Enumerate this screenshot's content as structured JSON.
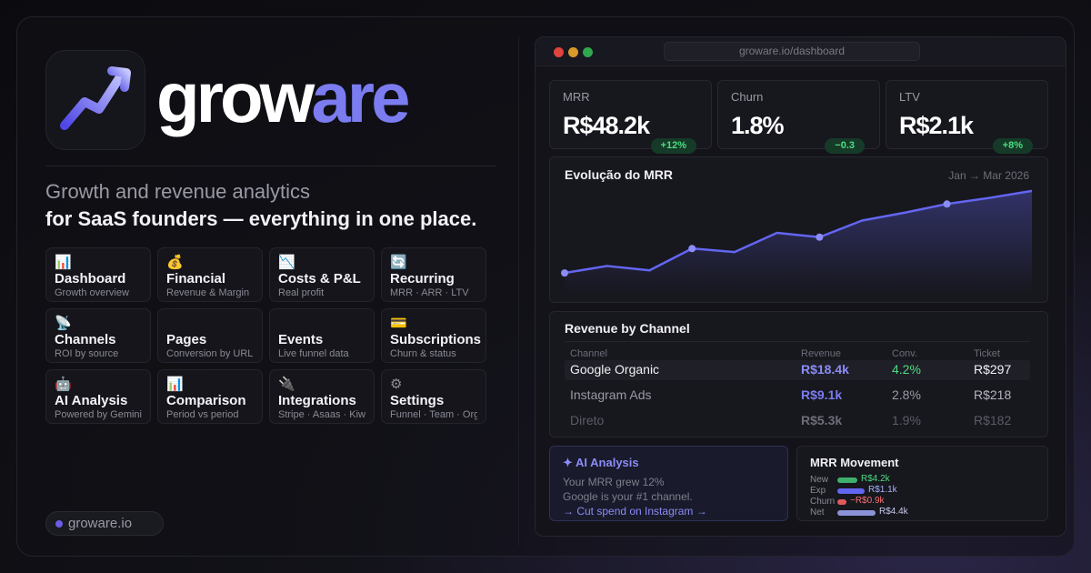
{
  "brand": {
    "name_part1": "grow",
    "name_part2": "are",
    "site": "groware.io"
  },
  "tagline": {
    "line1": "Growth and revenue analytics",
    "line2": "for SaaS founders — everything in one place."
  },
  "features": [
    {
      "icon": "bar-chart-icon",
      "glyph": "📊",
      "title": "Dashboard",
      "subtitle": "Growth overview"
    },
    {
      "icon": "money-bag-icon",
      "glyph": "💰",
      "title": "Financial",
      "subtitle": "Revenue & Margin"
    },
    {
      "icon": "trend-down-icon",
      "glyph": "📉",
      "title": "Costs & P&L",
      "subtitle": "Real profit"
    },
    {
      "icon": "refresh-icon",
      "glyph": "🔄",
      "title": "Recurring",
      "subtitle": "MRR · ARR · LTV"
    },
    {
      "icon": "satellite-icon",
      "glyph": "📡",
      "title": "Channels",
      "subtitle": "ROI by source"
    },
    {
      "icon": "page-icon",
      "glyph": "",
      "title": "Pages",
      "subtitle": "Conversion by URL"
    },
    {
      "icon": "event-icon",
      "glyph": "",
      "title": "Events",
      "subtitle": "Live funnel data"
    },
    {
      "icon": "card-icon",
      "glyph": "💳",
      "title": "Subscriptions",
      "subtitle": "Churn & status"
    },
    {
      "icon": "robot-icon",
      "glyph": "🤖",
      "title": "AI Analysis",
      "subtitle": "Powered by Gemini"
    },
    {
      "icon": "bar-chart-icon",
      "glyph": "📊",
      "title": "Comparison",
      "subtitle": "Period vs period"
    },
    {
      "icon": "plug-icon",
      "glyph": "🔌",
      "title": "Integrations",
      "subtitle": "Stripe · Asaas · Kiwify"
    },
    {
      "icon": "gear-icon",
      "glyph": "⚙",
      "title": "Settings",
      "subtitle": "Funnel · Team · Org"
    }
  ],
  "browser": {
    "url": "groware.io/dashboard"
  },
  "kpis": [
    {
      "label": "MRR",
      "value": "R$48.2k",
      "delta": "+12%"
    },
    {
      "label": "Churn",
      "value": "1.8%",
      "delta": "−0.3"
    },
    {
      "label": "LTV",
      "value": "R$2.1k",
      "delta": "+8%"
    }
  ],
  "mrr_chart": {
    "title": "Evolução do MRR",
    "range": "Jan → Mar 2026"
  },
  "chart_data": {
    "type": "area",
    "title": "Evolução do MRR",
    "x": [
      0,
      1,
      2,
      3,
      4,
      5,
      6,
      7,
      8,
      9,
      10,
      11
    ],
    "y": [
      3,
      11,
      6,
      31,
      27,
      49,
      44,
      63,
      72,
      82,
      89,
      97
    ],
    "highlighted_points": [
      0,
      3,
      6,
      9
    ],
    "grid": false,
    "ylim": [
      0,
      100
    ]
  },
  "revenue": {
    "title": "Revenue by Channel",
    "headers": [
      "Channel",
      "Revenue",
      "Conv.",
      "Ticket"
    ],
    "rows": [
      {
        "channel": "Google Organic",
        "revenue": "R$18.4k",
        "conv": "4.2%",
        "ticket": "R$297"
      },
      {
        "channel": "Instagram Ads",
        "revenue": "R$9.1k",
        "conv": "2.8%",
        "ticket": "R$218"
      },
      {
        "channel": "Direto",
        "revenue": "R$5.3k",
        "conv": "1.9%",
        "ticket": "R$182"
      }
    ]
  },
  "ai": {
    "title": "✦ AI Analysis",
    "line1": "Your MRR grew 12%",
    "line2": "Google is your #1 channel.",
    "link": "→ Cut spend on Instagram →"
  },
  "mrr_movement": {
    "title": "MRR Movement",
    "rows": [
      {
        "label": "New",
        "value": "R$4.2k",
        "share": 0.53,
        "color": "#3fb06a",
        "text_color": "#4ade80"
      },
      {
        "label": "Exp",
        "value": "R$1.1k",
        "share": 0.72,
        "color": "#6366f1",
        "text_color": "#a5b4fc"
      },
      {
        "label": "Churn",
        "value": "−R$0.9k",
        "share": 0.24,
        "color": "#e05a5a",
        "text_color": "#f87171"
      },
      {
        "label": "Net",
        "value": "R$4.4k",
        "share": 1.0,
        "color": "#8b93d8",
        "text_color": "#c7cbea"
      }
    ]
  }
}
